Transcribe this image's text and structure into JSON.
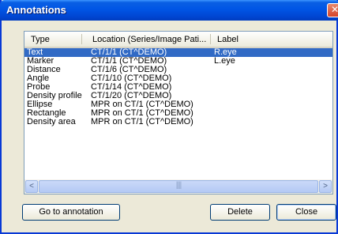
{
  "window": {
    "title": "Annotations",
    "close_glyph": "✕"
  },
  "columns": [
    "Type",
    "Location (Series/Image Pati...",
    "Label"
  ],
  "rows": [
    {
      "type": "Text",
      "location": "CT/1/1  (CT^DEMO)",
      "label": "R.eye",
      "selected": true
    },
    {
      "type": "Marker",
      "location": "CT/1/1  (CT^DEMO)",
      "label": "L.eye"
    },
    {
      "type": "Distance",
      "location": "CT/1/6  (CT^DEMO)",
      "label": ""
    },
    {
      "type": "Angle",
      "location": "CT/1/10  (CT^DEMO)",
      "label": ""
    },
    {
      "type": "Probe",
      "location": "CT/1/14  (CT^DEMO)",
      "label": ""
    },
    {
      "type": "Density profile",
      "location": "CT/1/20  (CT^DEMO)",
      "label": ""
    },
    {
      "type": "Ellipse",
      "location": "MPR on CT/1  (CT^DEMO)",
      "label": ""
    },
    {
      "type": "Rectangle",
      "location": "MPR on CT/1  (CT^DEMO)",
      "label": ""
    },
    {
      "type": "Density area",
      "location": "MPR on CT/1  (CT^DEMO)",
      "label": ""
    }
  ],
  "scrollbar": {
    "left_arrow": "<",
    "right_arrow": ">",
    "grip": "||||"
  },
  "buttons": {
    "go_to": "Go to annotation",
    "delete": "Delete",
    "close": "Close"
  },
  "colors": {
    "title_bar": "#0055e5",
    "selection": "#316ac5",
    "dialog_bg": "#ece9d8"
  }
}
